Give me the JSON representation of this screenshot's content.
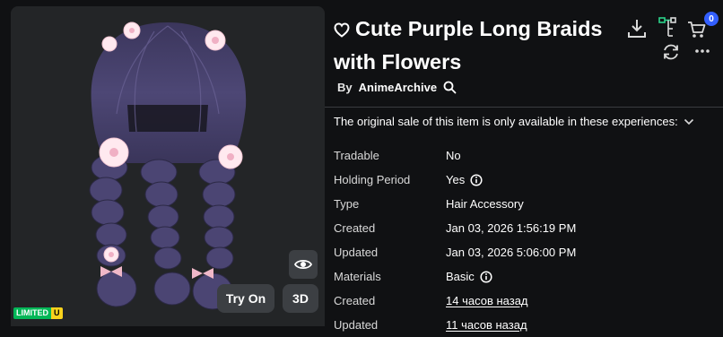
{
  "item": {
    "title": "Cute Purple Long Braids with Flowers",
    "by_prefix": "By",
    "creator": "AnimeArchive"
  },
  "preview": {
    "try_on_label": "Try On",
    "view_3d_label": "3D",
    "limited_label": "LIMITED",
    "limited_u": "U"
  },
  "cart": {
    "count": "0"
  },
  "sale_note": "The original sale of this item is only available in these experiences:",
  "details": [
    {
      "key": "Tradable",
      "value": "No"
    },
    {
      "key": "Holding Period",
      "value": "Yes"
    },
    {
      "key": "Type",
      "value": "Hair Accessory"
    },
    {
      "key": "Created",
      "value": "Jan 03, 2026 1:56:19 PM"
    },
    {
      "key": "Updated",
      "value": "Jan 03, 2026 5:06:00 PM"
    },
    {
      "key": "Materials",
      "value": "Basic"
    },
    {
      "key": "Created",
      "value": "14 часов назад"
    },
    {
      "key": "Updated",
      "value": "11 часов назад"
    }
  ],
  "colors": {
    "background": "#101113",
    "preview_bg": "#232527",
    "hair": "#4a4470",
    "accent_blue": "#335fff",
    "limited_green": "#02b757",
    "limited_yellow": "#f8d21c"
  },
  "icons": [
    "heart-outline-icon",
    "search-icon",
    "download-icon",
    "hierarchy-icon",
    "cart-icon",
    "refresh-icon",
    "more-icon",
    "eye-icon",
    "info-icon",
    "chevron-down-icon"
  ]
}
